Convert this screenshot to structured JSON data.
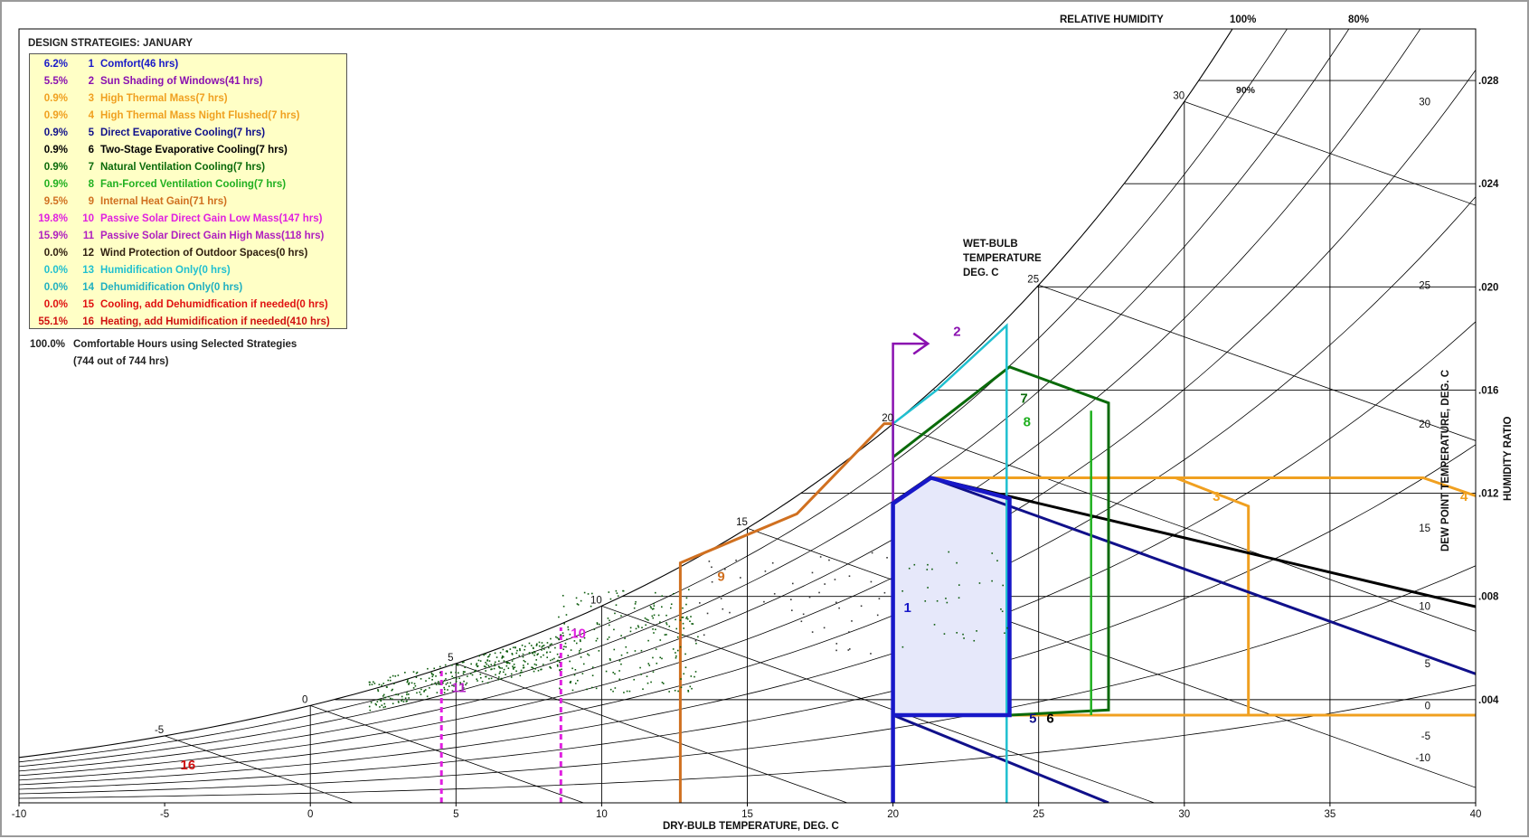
{
  "window": {
    "legend_title": "DESIGN STRATEGIES:  JANUARY",
    "summary_pct": "100.0%",
    "summary_line1": "Comfortable Hours using Selected Strategies",
    "summary_line2": "(744 out of 744 hrs)"
  },
  "strategies": [
    {
      "pct": "6.2%",
      "num": "1",
      "label": "Comfort(46 hrs)",
      "color": "#1818c8"
    },
    {
      "pct": "5.5%",
      "num": "2",
      "label": "Sun Shading of Windows(41 hrs)",
      "color": "#8a10b0"
    },
    {
      "pct": "0.9%",
      "num": "3",
      "label": "High Thermal Mass(7 hrs)",
      "color": "#f0a020"
    },
    {
      "pct": "0.9%",
      "num": "4",
      "label": "High Thermal Mass Night Flushed(7 hrs)",
      "color": "#f0a020"
    },
    {
      "pct": "0.9%",
      "num": "5",
      "label": "Direct Evaporative Cooling(7 hrs)",
      "color": "#10108a"
    },
    {
      "pct": "0.9%",
      "num": "6",
      "label": "Two-Stage Evaporative Cooling(7 hrs)",
      "color": "#000000"
    },
    {
      "pct": "0.9%",
      "num": "7",
      "label": "Natural Ventilation Cooling(7 hrs)",
      "color": "#0a6a0a"
    },
    {
      "pct": "0.9%",
      "num": "8",
      "label": "Fan-Forced Ventilation Cooling(7 hrs)",
      "color": "#20b020"
    },
    {
      "pct": "9.5%",
      "num": "9",
      "label": "Internal Heat Gain(71 hrs)",
      "color": "#d07020"
    },
    {
      "pct": "19.8%",
      "num": "10",
      "label": "Passive Solar Direct Gain Low Mass(147 hrs)",
      "color": "#e020e0"
    },
    {
      "pct": "15.9%",
      "num": "11",
      "label": "Passive Solar Direct Gain High Mass(118 hrs)",
      "color": "#b020c0"
    },
    {
      "pct": "0.0%",
      "num": "12",
      "label": "Wind Protection of Outdoor Spaces(0 hrs)",
      "color": "#302010"
    },
    {
      "pct": "0.0%",
      "num": "13",
      "label": "Humidification Only(0 hrs)",
      "color": "#20c0d0"
    },
    {
      "pct": "0.0%",
      "num": "14",
      "label": "Dehumidification Only(0 hrs)",
      "color": "#20b0c0"
    },
    {
      "pct": "0.0%",
      "num": "15",
      "label": "Cooling, add Dehumidfication if needed(0 hrs)",
      "color": "#e01010"
    },
    {
      "pct": "55.1%",
      "num": "16",
      "label": "Heating, add Humidification if needed(410 hrs)",
      "color": "#d01010"
    }
  ],
  "annotations": {
    "relative_humidity": "RELATIVE HUMIDITY",
    "rh_100": "100%",
    "rh_80": "80%",
    "rh_90": "90%",
    "wet_bulb_1": "WET-BULB",
    "wet_bulb_2": "TEMPERATURE",
    "wet_bulb_3": "DEG. C",
    "x_axis_title": "DRY-BULB TEMPERATURE, DEG. C",
    "dew_point_title": "DEW POINT TEMPERATURE, DEG. C",
    "humidity_ratio_title": "HUMIDITY RATIO"
  },
  "chart_data": {
    "type": "scatter",
    "title": "DESIGN STRATEGIES:  JANUARY",
    "xlabel": "DRY-BULB TEMPERATURE, DEG. C",
    "ylabel": "HUMIDITY RATIO",
    "xlim": [
      -10,
      40
    ],
    "ylim": [
      0,
      0.03
    ],
    "x_ticks": [
      "-10",
      "-5",
      "0",
      "5",
      "10",
      "15",
      "20",
      "25",
      "30",
      "35",
      "40"
    ],
    "humidity_ratio_ticks": [
      ".004",
      ".008",
      ".012",
      ".016",
      ".020",
      ".024",
      ".028"
    ],
    "dew_point_ticks": [
      "-10",
      "-5",
      "0",
      "5",
      "10",
      "15",
      "20",
      "25",
      "30"
    ],
    "wet_bulb_ticks": [
      "-5",
      "0",
      "5",
      "10",
      "15",
      "20",
      "25",
      "30"
    ],
    "zone_labels": [
      {
        "num": "1",
        "x": 20.5,
        "w": 0.0074
      },
      {
        "num": "2",
        "x": 22.2,
        "w": 0.0181
      },
      {
        "num": "3",
        "x": 31.1,
        "w": 0.0117
      },
      {
        "num": "4",
        "x": 39.6,
        "w": 0.0117
      },
      {
        "num": "5",
        "x": 24.8,
        "w": 0.0031
      },
      {
        "num": "6",
        "x": 25.4,
        "w": 0.0031
      },
      {
        "num": "7",
        "x": 24.5,
        "w": 0.0155
      },
      {
        "num": "8",
        "x": 24.6,
        "w": 0.0146
      },
      {
        "num": "9",
        "x": 14.1,
        "w": 0.0086
      },
      {
        "num": "10",
        "x": 9.2,
        "w": 0.0064
      },
      {
        "num": "11",
        "x": 5.1,
        "w": 0.0043
      },
      {
        "num": "16",
        "x": -4.2,
        "w": 0.0013
      }
    ]
  }
}
